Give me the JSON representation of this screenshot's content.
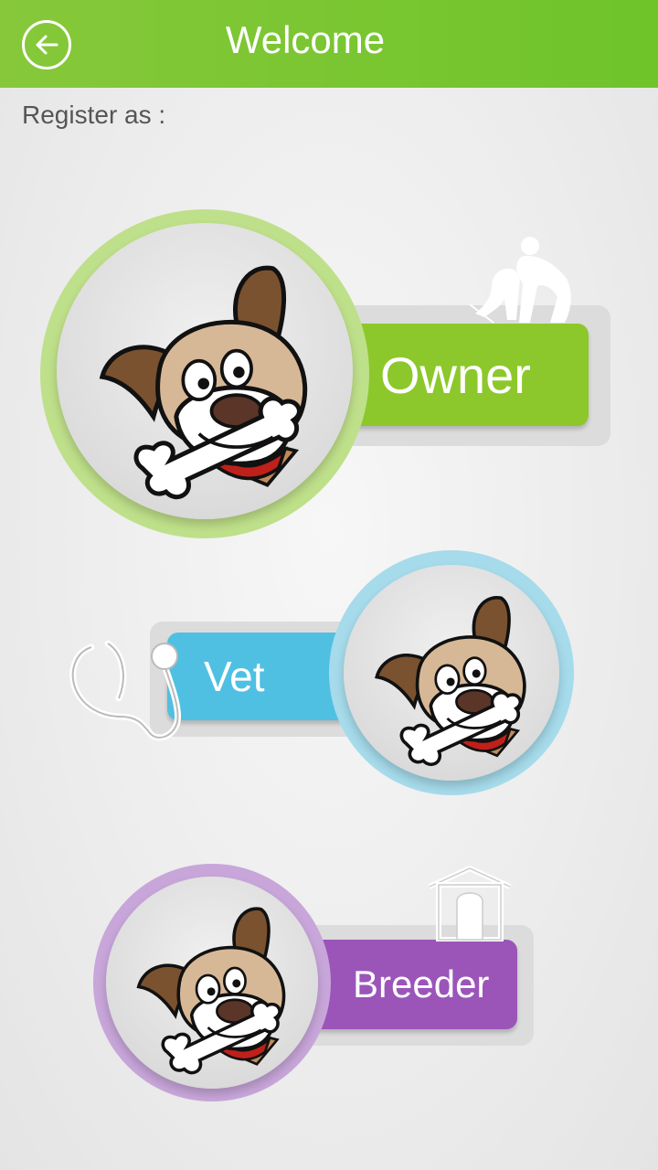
{
  "header": {
    "title": "Welcome",
    "back_icon": "arrow-left-circle-icon",
    "color": "#7cc632"
  },
  "prompt": "Register as :",
  "options": [
    {
      "label": "Owner",
      "color": "#8cc82b",
      "ring_color": "#bfe08a",
      "icon": "owner-with-dog-icon"
    },
    {
      "label": "Vet",
      "color": "#4fc0e2",
      "ring_color": "#a6dbeb",
      "icon": "stethoscope-icon"
    },
    {
      "label": "Breeder",
      "color": "#9b55b9",
      "ring_color": "#c8a6da",
      "icon": "dog-house-icon"
    }
  ]
}
